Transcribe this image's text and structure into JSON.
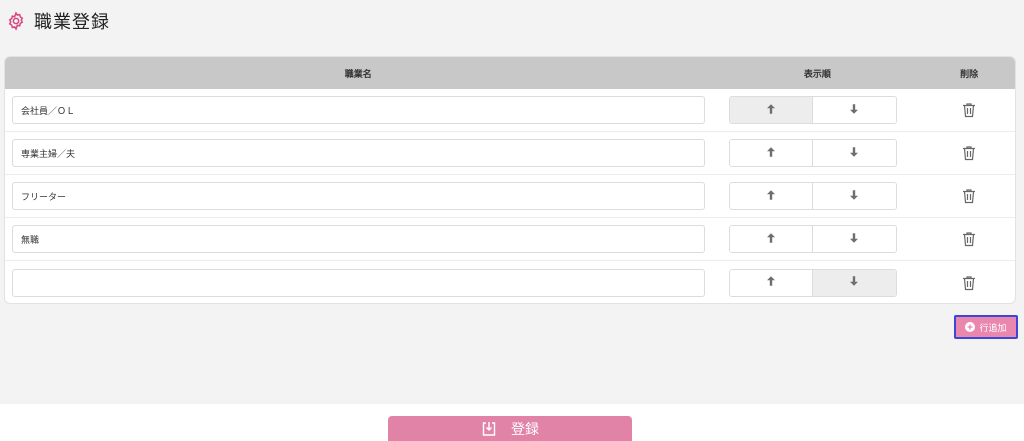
{
  "header": {
    "title": "職業登録",
    "icon": "gear-icon",
    "accent_color": "#d9457f"
  },
  "table": {
    "columns": {
      "name": "職業名",
      "order": "表示順",
      "delete": "削除"
    },
    "rows": [
      {
        "value": "会社員／ＯＬ",
        "up_disabled": true,
        "down_disabled": false
      },
      {
        "value": "専業主婦／夫",
        "up_disabled": false,
        "down_disabled": false
      },
      {
        "value": "フリーター",
        "up_disabled": false,
        "down_disabled": false
      },
      {
        "value": "無職",
        "up_disabled": false,
        "down_disabled": false
      },
      {
        "value": "",
        "up_disabled": false,
        "down_disabled": true
      }
    ],
    "up_icon": "arrow-up-icon",
    "down_icon": "arrow-down-icon",
    "delete_icon": "trash-icon"
  },
  "add_row_button": {
    "label": "行追加",
    "icon": "plus-circle-icon",
    "color": "#e987ae"
  },
  "register_button": {
    "label": "登録",
    "icon": "save-icon",
    "color": "#e183a7"
  }
}
